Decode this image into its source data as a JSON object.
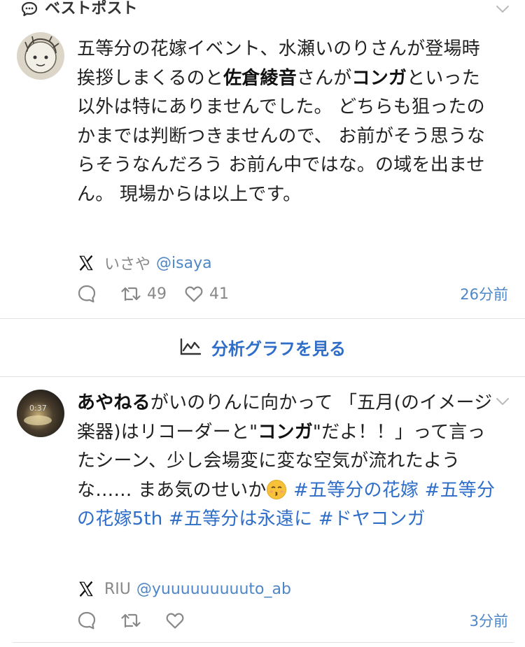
{
  "section": {
    "title": "ベストポスト"
  },
  "posts": [
    {
      "segments": [
        "五等分の花嫁イベント、水瀬いのりさんが登場時挨拶しまくるのと",
        "佐倉綾音",
        "さんが",
        "コンガ",
        "といった以外は特にありませんでした。 どちらも狙ったのかまでは判断つきませんので、 お前がそう思うならそうなんだろう お前ん中ではな。の域を出ません。 現場からは以上です。"
      ],
      "author_name": "いさや",
      "author_handle": "@isaya",
      "replies": "",
      "reposts": "49",
      "likes": "41",
      "time": "26分前"
    },
    {
      "avatar_text": "0:37",
      "segments": [
        "あやねる",
        "がいのりんに向かって 「五月(のイメージ楽器)はリコーダーと\"",
        "コンガ",
        "\"だよ！！」って言ったシーン、少し会場変に変な空気が流れたような…… まあ気のせいか"
      ],
      "hashtags": [
        "#五等分の花嫁",
        "#五等分の花嫁5th",
        "#五等分は永遠に",
        "#ドヤコンガ"
      ],
      "author_name": "RIU",
      "author_handle": "@yuuuuuuuuuto_ab",
      "replies": "",
      "reposts": "",
      "likes": "",
      "time": "3分前"
    }
  ],
  "analytics": {
    "label": "分析グラフを見る"
  },
  "colors": {
    "link": "#2f6ec8",
    "handle": "#4f86c6",
    "muted": "#888888",
    "divider": "#e2e2e2"
  },
  "icons": [
    "chat-bubble-icon",
    "chevron-down-icon",
    "x-logo-icon",
    "reply-icon",
    "repost-icon",
    "like-icon",
    "chart-icon",
    "kissing-emoji-icon"
  ]
}
